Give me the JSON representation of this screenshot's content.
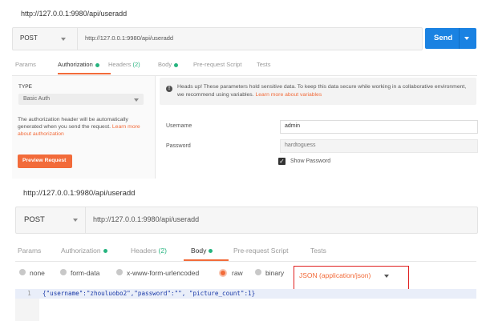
{
  "panel1": {
    "title": "http://127.0.0.1:9980/api/useradd",
    "method": "POST",
    "url": "http://127.0.0.1:9980/api/useradd",
    "send_label": "Send",
    "tabs": [
      "Params",
      "Authorization",
      "Headers",
      "(2)",
      "Body",
      "Pre-request Script",
      "Tests"
    ],
    "auth": {
      "type_label": "TYPE",
      "type_value": "Basic Auth",
      "description": "The authorization header will be automatically generated when you send the request. ",
      "learn_more": "Learn more about authorization",
      "preview_button": "Preview Request"
    },
    "note": {
      "text": "Heads up! These parameters hold sensitive data. To keep this data secure while working in a collaborative environment, we recommend using variables. ",
      "learn_more": "Learn more about variables"
    },
    "username_label": "Username",
    "username_value": "admin",
    "password_label": "Password",
    "password_value": "hardtoguess",
    "show_password_label": "Show Password"
  },
  "panel2": {
    "title": "http://127.0.0.1:9980/api/useradd",
    "method": "POST",
    "url": "http://127.0.0.1:9980/api/useradd",
    "tabs": [
      "Params",
      "Authorization",
      "Headers",
      "(2)",
      "Body",
      "Pre-request Script",
      "Tests"
    ],
    "body_modes": [
      "none",
      "form-data",
      "x-www-form-urlencoded",
      "raw",
      "binary"
    ],
    "content_type": "JSON (application/json)",
    "line_number": "1",
    "code": "{\"username\":\"zhouluobo2\",\"password\":\"\", \"picture_count\":1}"
  },
  "colors": {
    "accent": "#f26b3a",
    "send_blue": "#1a82e2",
    "status_green": "#26b47f",
    "highlight_red": "#e02020"
  }
}
